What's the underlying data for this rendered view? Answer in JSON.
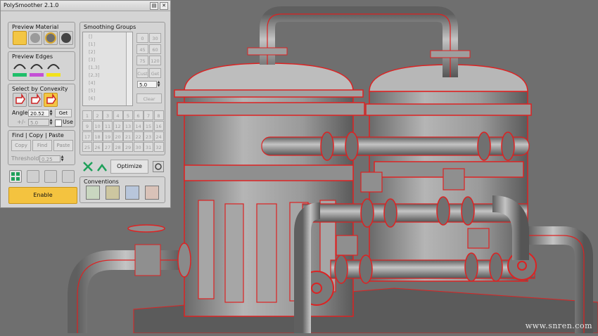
{
  "panel": {
    "title": "PolySmoother 2.1.0",
    "preview_material": {
      "label": "Preview Material",
      "icons": [
        "material-flat-icon",
        "material-sphere-icon",
        "material-gold-sphere-icon",
        "material-dark-icon"
      ]
    },
    "preview_edges": {
      "label": "Preview Edges",
      "colors": [
        "#1fbf6a",
        "#c44fd6",
        "#f2e21a"
      ]
    },
    "select_by_convexity": {
      "label": "Select by Convexity",
      "angle_label": "Angle:",
      "angle_value": "20.52",
      "get_label": "Get",
      "pm_label": "+/-",
      "pm_value": "5.0",
      "use_label": "Use"
    },
    "find_copy_paste": {
      "label": "Find | Copy | Paste",
      "copy": "Copy",
      "find": "Find",
      "paste": "Paste",
      "threshold_label": "Threshold:",
      "threshold_value": "0.25"
    },
    "enable_label": "Enable",
    "smoothing_groups": {
      "label": "Smoothing Groups",
      "list_items": [
        "[]",
        "[1]",
        "[2]",
        "[3]",
        "[1,3]",
        "[2,3]",
        "[4]",
        "[5]",
        "[6]"
      ],
      "angle_buttons": [
        "0",
        "30",
        "45",
        "60",
        "75",
        "120"
      ],
      "cust_label": "Cust",
      "get_label": "Get",
      "value": "5.0",
      "clear_label": "Clear",
      "numbers": [
        "1",
        "2",
        "3",
        "4",
        "5",
        "6",
        "7",
        "8",
        "9",
        "10",
        "11",
        "12",
        "13",
        "14",
        "15",
        "16",
        "17",
        "18",
        "19",
        "20",
        "21",
        "22",
        "23",
        "24",
        "25",
        "26",
        "27",
        "28",
        "29",
        "30",
        "31",
        "32"
      ]
    },
    "optimize_label": "Optimize",
    "conversions": {
      "label": "Conventions",
      "icons": [
        "convert-a-icon",
        "convert-b-icon",
        "convert-c-icon",
        "convert-d-icon"
      ]
    }
  },
  "watermark": "www.snren.com",
  "colors": {
    "accent": "#f4c33f",
    "wire": "#e0241b",
    "model": "#8c8c8c",
    "bg": "#6f6f6f"
  }
}
